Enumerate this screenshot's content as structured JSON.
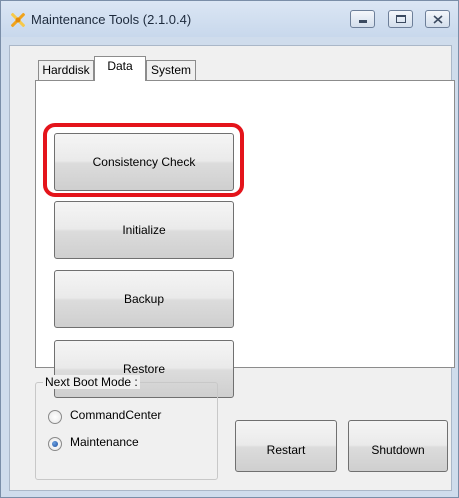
{
  "window": {
    "title": "Maintenance Tools (2.1.0.4)"
  },
  "tabs": [
    {
      "label": "Harddisk",
      "active": false
    },
    {
      "label": "Data",
      "active": true
    },
    {
      "label": "System",
      "active": false
    }
  ],
  "actions": {
    "consistency_check": "Consistency Check",
    "initialize": "Initialize",
    "backup": "Backup",
    "restore": "Restore"
  },
  "boot_mode": {
    "title": "Next Boot Mode :",
    "options": [
      {
        "label": "CommandCenter",
        "selected": false
      },
      {
        "label": "Maintenance",
        "selected": true
      }
    ]
  },
  "buttons": {
    "restart": "Restart",
    "shutdown": "Shutdown"
  },
  "colors": {
    "highlight": "#e4141b",
    "titlebar": "#cfdcec"
  }
}
